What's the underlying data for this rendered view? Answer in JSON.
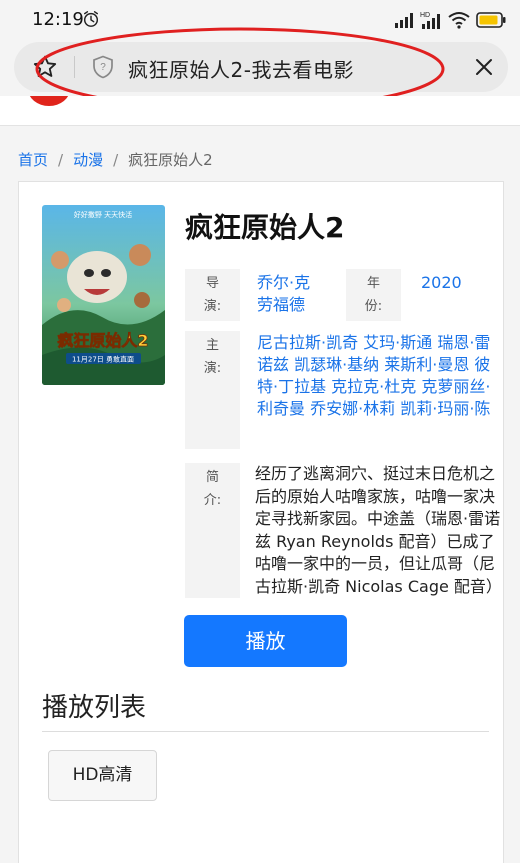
{
  "status_bar": {
    "time": "12:19",
    "icons": [
      "alarm-icon",
      "signal-icon",
      "hd-signal-icon",
      "wifi-icon",
      "battery-icon"
    ],
    "hd_label": "HD",
    "battery_color": "#f5c400"
  },
  "browser": {
    "page_title": "疯狂原始人2-我去看电影",
    "icons": [
      "star-icon",
      "shield-icon",
      "close-icon"
    ],
    "annotation_color": "#e02020"
  },
  "site": {
    "brand_color": "#e0241b"
  },
  "breadcrumb": {
    "items": [
      "首页",
      "动漫",
      "疯狂原始人2"
    ],
    "separator": "/"
  },
  "movie": {
    "title": "疯狂原始人2",
    "poster": {
      "title": "疯狂原始人2",
      "tagline": "好好撒野 天天快活",
      "date": "11月27日 勇敢直面"
    },
    "director_label": "导演:",
    "director": "乔尔·克劳福德",
    "year_label": "年份:",
    "year": "2020",
    "cast_label": "主演:",
    "cast": "尼古拉斯·凯奇 艾玛·斯通 瑞恩·雷诺兹 凯瑟琳·基纳 莱斯利·曼恩 彼特·丁拉基 克拉克·杜克 克萝丽丝·利奇曼 乔安娜·林莉 凯莉·玛丽·陈",
    "synopsis_label": "简介:",
    "synopsis": "经历了逃离洞穴、挺过末日危机之后的原始人咕噜家族，咕噜一家决定寻找新家园。中途盖（瑞恩·雷诺兹 Ryan Reynolds 配音）已成了咕噜一家中的一员，但让瓜哥（尼古拉斯·凯奇 Nicolas Cage 配音）头",
    "accent_color": "#1a73e8"
  },
  "actions": {
    "play_label": "播放",
    "play_color": "#1478ff"
  },
  "playlist": {
    "heading": "播放列表",
    "episodes": [
      "HD高清"
    ]
  }
}
